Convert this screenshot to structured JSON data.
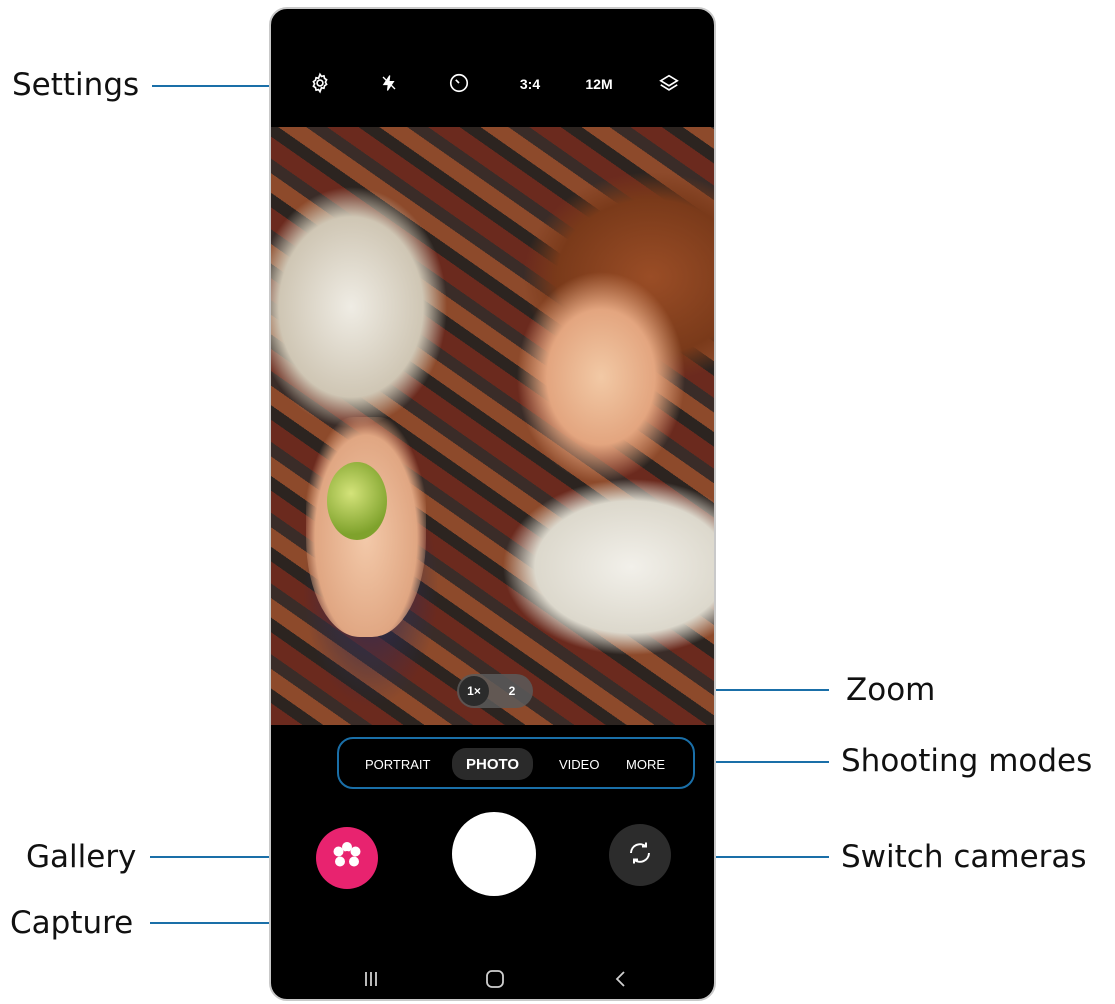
{
  "callouts": {
    "settings": "Settings",
    "zoom": "Zoom",
    "shooting_modes": "Shooting modes",
    "gallery": "Gallery",
    "switch_cameras": "Switch cameras",
    "capture": "Capture"
  },
  "topbar": {
    "icons": [
      "gear-icon",
      "flash-off-icon",
      "timer-icon",
      "layers-icon"
    ],
    "ratio": "3:4",
    "resolution": "12M"
  },
  "zoom": {
    "options": [
      "1×",
      "2"
    ],
    "selected": "1×"
  },
  "modes": {
    "items": [
      "PORTRAIT",
      "PHOTO",
      "VIDEO",
      "MORE"
    ],
    "selected": "PHOTO"
  },
  "colors": {
    "callout_line": "#1a6fa8",
    "gallery": "#e8236f",
    "background": "#000000"
  },
  "navbar": {
    "icons": [
      "recent-apps-icon",
      "home-icon",
      "back-icon"
    ]
  }
}
